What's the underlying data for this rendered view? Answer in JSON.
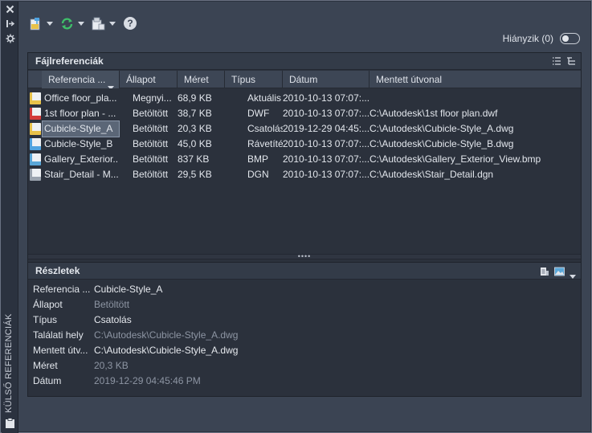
{
  "sidebar": {
    "close_icon": "close-icon",
    "title": "KÜLSŐ REFERENCIÁK"
  },
  "toolbar": {
    "hidden_toggle_label": "Hiányzik (0)"
  },
  "file_refs": {
    "title": "Fájlreferenciák",
    "columns": [
      "Referencia ...",
      "Állapot",
      "Méret",
      "Típus",
      "Dátum",
      "Mentett útvonal"
    ],
    "rows": [
      {
        "name": "Office floor_pla...",
        "status": "Megnyi...",
        "size": "68,9 KB",
        "type": "Aktuális",
        "date": "2010-10-13 07:07:...",
        "path": "",
        "icon_color": "#e8c24a"
      },
      {
        "name": "1st floor plan - ...",
        "status": "Betöltött",
        "size": "38,7 KB",
        "type": "DWF",
        "date": "2010-10-13 07:07:...",
        "path": "C:\\Autodesk\\1st floor plan.dwf",
        "icon_color": "#d23a3a"
      },
      {
        "name": "Cubicle-Style_A",
        "status": "Betöltött",
        "size": "20,3 KB",
        "type": "Csatolás",
        "date": "2019-12-29 04:45:...",
        "path": "C:\\Autodesk\\Cubicle-Style_A.dwg",
        "icon_color": "#e8c24a"
      },
      {
        "name": "Cubicle-Style_B",
        "status": "Betöltött",
        "size": "45,0 KB",
        "type": "Rávetítés",
        "date": "2010-10-13 07:07:...",
        "path": "C:\\Autodesk\\Cubicle-Style_B.dwg",
        "icon_color": "#4fa3e0"
      },
      {
        "name": "Gallery_Exterior...",
        "status": "Betöltött",
        "size": "837 KB",
        "type": "BMP",
        "date": "2010-10-13 07:07:...",
        "path": "C:\\Autodesk\\Gallery_Exterior_View.bmp",
        "icon_color": "#5aa7d8"
      },
      {
        "name": "Stair_Detail - M...",
        "status": "Betöltött",
        "size": "29,5 KB",
        "type": "DGN",
        "date": "2010-10-13 07:07:...",
        "path": "C:\\Autodesk\\Stair_Detail.dgn",
        "icon_color": "#9aa3ae"
      }
    ],
    "selected_index": 2
  },
  "details": {
    "title": "Részletek",
    "fields": [
      {
        "label": "Referencia ...",
        "value": "Cubicle-Style_A",
        "dim": false
      },
      {
        "label": "Állapot",
        "value": "Betöltött",
        "dim": true
      },
      {
        "label": "Típus",
        "value": "Csatolás",
        "dim": false
      },
      {
        "label": "Találati hely",
        "value": "C:\\Autodesk\\Cubicle-Style_A.dwg",
        "dim": true
      },
      {
        "label": "Mentett útv...",
        "value": "C:\\Autodesk\\Cubicle-Style_A.dwg",
        "dim": false
      },
      {
        "label": "Méret",
        "value": "20,3 KB",
        "dim": true
      },
      {
        "label": "Dátum",
        "value": "2019-12-29 04:45:46 PM",
        "dim": true
      }
    ]
  },
  "colors": {
    "accent_green": "#3fbf6a",
    "accent_yellow": "#e8c24a",
    "selection": "#5b6677"
  }
}
